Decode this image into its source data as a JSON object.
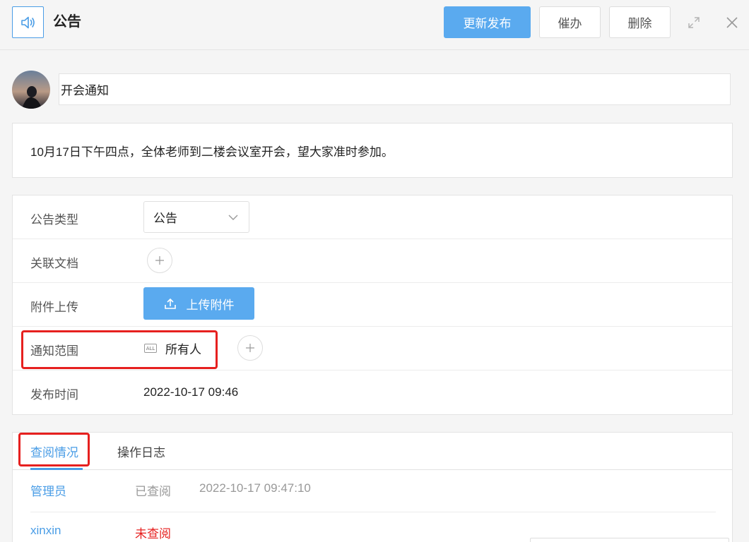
{
  "header": {
    "title": "公告",
    "icon": "speaker-icon",
    "buttons": {
      "republish": "更新发布",
      "urge": "催办",
      "delete": "删除"
    }
  },
  "notice": {
    "title": "开会通知",
    "content": "10月17日下午四点，全体老师到二楼会议室开会，望大家准时参加。"
  },
  "form": {
    "type_label": "公告类型",
    "type_value": "公告",
    "docs_label": "关联文档",
    "attach_label": "附件上传",
    "upload_button": "上传附件",
    "scope_label": "通知范围",
    "scope_icon_text": "ALL",
    "scope_value": "所有人",
    "time_label": "发布时间",
    "time_value": "2022-10-17 09:46"
  },
  "tabs": {
    "read_status": "查阅情况",
    "operation_log": "操作日志"
  },
  "readers": [
    {
      "name": "管理员",
      "status": "已查阅",
      "time": "2022-10-17 09:47:10"
    },
    {
      "name": "xinxin",
      "status": "未查阅",
      "time": ""
    }
  ],
  "colors": {
    "accent": "#5aaaef",
    "link": "#4a9de6",
    "highlight": "#e6201f",
    "unread": "#e6201f"
  }
}
